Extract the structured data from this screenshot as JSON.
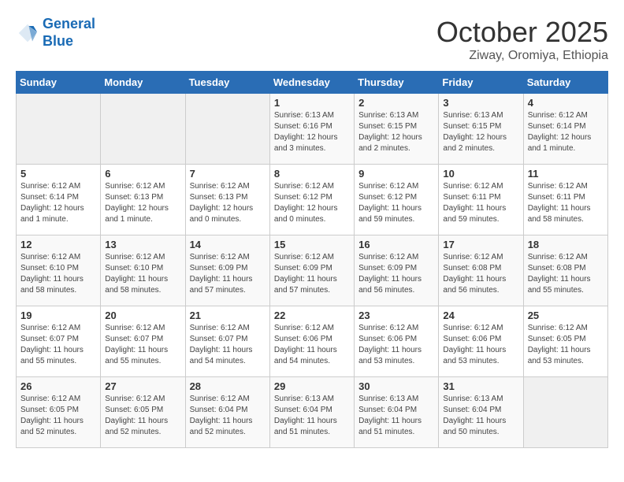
{
  "logo": {
    "line1": "General",
    "line2": "Blue"
  },
  "title": "October 2025",
  "subtitle": "Ziway, Oromiya, Ethiopia",
  "days_of_week": [
    "Sunday",
    "Monday",
    "Tuesday",
    "Wednesday",
    "Thursday",
    "Friday",
    "Saturday"
  ],
  "weeks": [
    [
      {
        "day": "",
        "info": ""
      },
      {
        "day": "",
        "info": ""
      },
      {
        "day": "",
        "info": ""
      },
      {
        "day": "1",
        "info": "Sunrise: 6:13 AM\nSunset: 6:16 PM\nDaylight: 12 hours\nand 3 minutes."
      },
      {
        "day": "2",
        "info": "Sunrise: 6:13 AM\nSunset: 6:15 PM\nDaylight: 12 hours\nand 2 minutes."
      },
      {
        "day": "3",
        "info": "Sunrise: 6:13 AM\nSunset: 6:15 PM\nDaylight: 12 hours\nand 2 minutes."
      },
      {
        "day": "4",
        "info": "Sunrise: 6:12 AM\nSunset: 6:14 PM\nDaylight: 12 hours\nand 1 minute."
      }
    ],
    [
      {
        "day": "5",
        "info": "Sunrise: 6:12 AM\nSunset: 6:14 PM\nDaylight: 12 hours\nand 1 minute."
      },
      {
        "day": "6",
        "info": "Sunrise: 6:12 AM\nSunset: 6:13 PM\nDaylight: 12 hours\nand 1 minute."
      },
      {
        "day": "7",
        "info": "Sunrise: 6:12 AM\nSunset: 6:13 PM\nDaylight: 12 hours\nand 0 minutes."
      },
      {
        "day": "8",
        "info": "Sunrise: 6:12 AM\nSunset: 6:12 PM\nDaylight: 12 hours\nand 0 minutes."
      },
      {
        "day": "9",
        "info": "Sunrise: 6:12 AM\nSunset: 6:12 PM\nDaylight: 11 hours\nand 59 minutes."
      },
      {
        "day": "10",
        "info": "Sunrise: 6:12 AM\nSunset: 6:11 PM\nDaylight: 11 hours\nand 59 minutes."
      },
      {
        "day": "11",
        "info": "Sunrise: 6:12 AM\nSunset: 6:11 PM\nDaylight: 11 hours\nand 58 minutes."
      }
    ],
    [
      {
        "day": "12",
        "info": "Sunrise: 6:12 AM\nSunset: 6:10 PM\nDaylight: 11 hours\nand 58 minutes."
      },
      {
        "day": "13",
        "info": "Sunrise: 6:12 AM\nSunset: 6:10 PM\nDaylight: 11 hours\nand 58 minutes."
      },
      {
        "day": "14",
        "info": "Sunrise: 6:12 AM\nSunset: 6:09 PM\nDaylight: 11 hours\nand 57 minutes."
      },
      {
        "day": "15",
        "info": "Sunrise: 6:12 AM\nSunset: 6:09 PM\nDaylight: 11 hours\nand 57 minutes."
      },
      {
        "day": "16",
        "info": "Sunrise: 6:12 AM\nSunset: 6:09 PM\nDaylight: 11 hours\nand 56 minutes."
      },
      {
        "day": "17",
        "info": "Sunrise: 6:12 AM\nSunset: 6:08 PM\nDaylight: 11 hours\nand 56 minutes."
      },
      {
        "day": "18",
        "info": "Sunrise: 6:12 AM\nSunset: 6:08 PM\nDaylight: 11 hours\nand 55 minutes."
      }
    ],
    [
      {
        "day": "19",
        "info": "Sunrise: 6:12 AM\nSunset: 6:07 PM\nDaylight: 11 hours\nand 55 minutes."
      },
      {
        "day": "20",
        "info": "Sunrise: 6:12 AM\nSunset: 6:07 PM\nDaylight: 11 hours\nand 55 minutes."
      },
      {
        "day": "21",
        "info": "Sunrise: 6:12 AM\nSunset: 6:07 PM\nDaylight: 11 hours\nand 54 minutes."
      },
      {
        "day": "22",
        "info": "Sunrise: 6:12 AM\nSunset: 6:06 PM\nDaylight: 11 hours\nand 54 minutes."
      },
      {
        "day": "23",
        "info": "Sunrise: 6:12 AM\nSunset: 6:06 PM\nDaylight: 11 hours\nand 53 minutes."
      },
      {
        "day": "24",
        "info": "Sunrise: 6:12 AM\nSunset: 6:06 PM\nDaylight: 11 hours\nand 53 minutes."
      },
      {
        "day": "25",
        "info": "Sunrise: 6:12 AM\nSunset: 6:05 PM\nDaylight: 11 hours\nand 53 minutes."
      }
    ],
    [
      {
        "day": "26",
        "info": "Sunrise: 6:12 AM\nSunset: 6:05 PM\nDaylight: 11 hours\nand 52 minutes."
      },
      {
        "day": "27",
        "info": "Sunrise: 6:12 AM\nSunset: 6:05 PM\nDaylight: 11 hours\nand 52 minutes."
      },
      {
        "day": "28",
        "info": "Sunrise: 6:12 AM\nSunset: 6:04 PM\nDaylight: 11 hours\nand 52 minutes."
      },
      {
        "day": "29",
        "info": "Sunrise: 6:13 AM\nSunset: 6:04 PM\nDaylight: 11 hours\nand 51 minutes."
      },
      {
        "day": "30",
        "info": "Sunrise: 6:13 AM\nSunset: 6:04 PM\nDaylight: 11 hours\nand 51 minutes."
      },
      {
        "day": "31",
        "info": "Sunrise: 6:13 AM\nSunset: 6:04 PM\nDaylight: 11 hours\nand 50 minutes."
      },
      {
        "day": "",
        "info": ""
      }
    ]
  ]
}
